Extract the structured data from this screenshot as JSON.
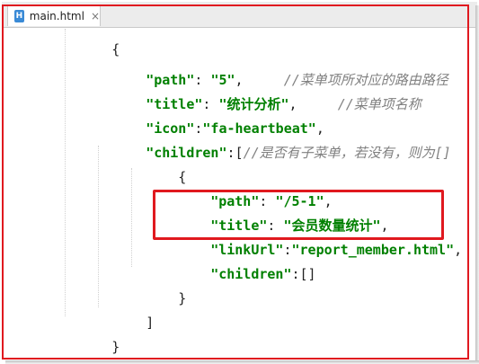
{
  "tab": {
    "icon_letter": "H",
    "label": "main.html",
    "close": "×"
  },
  "code": {
    "top_partial": "{",
    "line1": {
      "key": "\"path\"",
      "colon": ": ",
      "value": "\"5\"",
      "comma": ",",
      "comment": "//菜单项所对应的路由路径"
    },
    "line2": {
      "key": "\"title\"",
      "colon": ": ",
      "value": "\"统计分析\"",
      "comma": ",",
      "comment": "//菜单项名称"
    },
    "line3": {
      "key": "\"icon\"",
      "colon": ":",
      "value": "\"fa-heartbeat\"",
      "comma": ","
    },
    "line4": {
      "key": "\"children\"",
      "colon": ":[",
      "comment": "//是否有子菜单，若没有，则为[]"
    },
    "line5": {
      "brace": "{"
    },
    "line6": {
      "key": "\"path\"",
      "colon": ": ",
      "value": "\"/5-1\"",
      "comma": ","
    },
    "line7": {
      "key": "\"title\"",
      "colon": ": ",
      "value": "\"会员数量统计\"",
      "comma": ","
    },
    "line8": {
      "key": "\"linkUrl\"",
      "colon": ":",
      "value": "\"report_member.html\"",
      "comma": ","
    },
    "line9": {
      "key": "\"children\"",
      "colon": ":[]"
    },
    "line10": {
      "brace": "}"
    },
    "line11": {
      "bracket": "]"
    },
    "line12": {
      "brace": "}"
    },
    "line13": {
      "bracket": "],"
    }
  },
  "colors": {
    "keyword_green": "#008000",
    "comment_gray": "#808080",
    "highlight_red": "#e0191f"
  }
}
